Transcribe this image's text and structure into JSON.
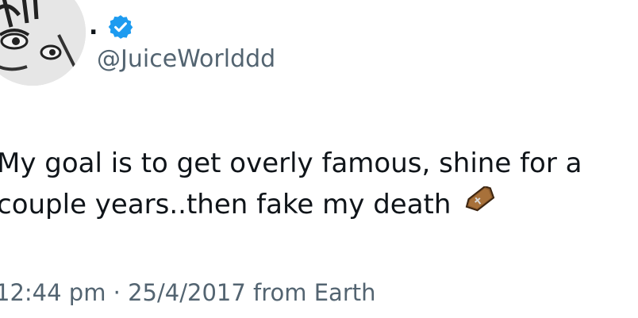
{
  "profile": {
    "display_name": ".",
    "handle": "@JuiceWorlddd",
    "verified_icon": "verified-badge-icon",
    "verified_color": "#1d9bf0"
  },
  "tweet": {
    "line1": "My goal is to get overly famous, shine for a",
    "line2": "couple years..then fake my death",
    "emoji": "coffin-icon"
  },
  "meta": {
    "time": "12:44 pm",
    "separator": "·",
    "date": "25/4/2017",
    "source": "from Earth"
  }
}
